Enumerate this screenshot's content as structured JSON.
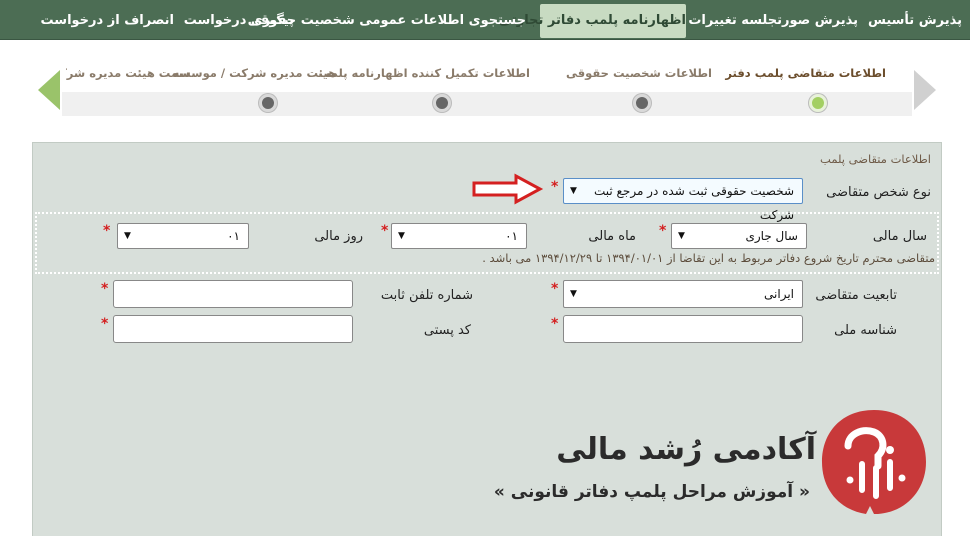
{
  "nav": {
    "items": [
      "پذیرش تأسیس",
      "پذیرش صورتجلسه تغییرات",
      "اظهارنامه پلمب دفاتر تجارتی",
      "جستجوی اطلاعات عمومی شخصیت حقوقی",
      "پیگیری درخواست",
      "انصراف از درخواست"
    ]
  },
  "steps": [
    "اطلاعات متقاضی پلمب دفتر",
    "اطلاعات شخصیت حقوقی",
    "اطلاعات تکمیل کننده اظهارنامه پلمب",
    "هیئت مدیره شرکت / موسسه",
    "سمت هیئت مدیره شرکت م"
  ],
  "form": {
    "section_title": "اطلاعات متقاضی پلمب",
    "applicant_type_label": "نوع شخص متقاضی",
    "applicant_type_value": "شخصیت حقوقی ثبت شده در مرجع ثبت شرکت",
    "fiscal_year_label": "سال مالی",
    "fiscal_year_value": "سال جاری",
    "fiscal_month_label": "ماه مالی",
    "fiscal_month_value": "۰۱",
    "fiscal_day_label": "روز مالی",
    "fiscal_day_value": "۰۱",
    "note": "متقاضی محترم تاریخ شروع دفاتر مربوط به این تقاضا از ۱۳۹۴/۰۱/۰۱ تا ۱۳۹۴/۱۲/۲۹ می باشد .",
    "nationality_label": "تابعیت متقاضی",
    "nationality_value": "ایرانی",
    "phone_label": "شماره تلفن ثابت",
    "national_id_label": "شناسه ملی",
    "postal_code_label": "کد پستی",
    "required_mark": "*"
  },
  "logo": {
    "title": "آکادمی رُشد مالی",
    "subtitle": "« آموزش مراحل پلمپ دفاتر قانونی »"
  },
  "colors": {
    "nav_bg": "#4c6d54",
    "nav_active_bg": "#c8dbc2",
    "panel_bg": "#d8dfda",
    "accent_green": "#a3cf62",
    "required_red": "#d42020",
    "logo_red": "#c8393a"
  },
  "icons": {
    "prev": "chevron-left-icon",
    "next": "chevron-right-icon",
    "annotation": "red-arrow-icon",
    "logo": "academy-logo-icon"
  }
}
